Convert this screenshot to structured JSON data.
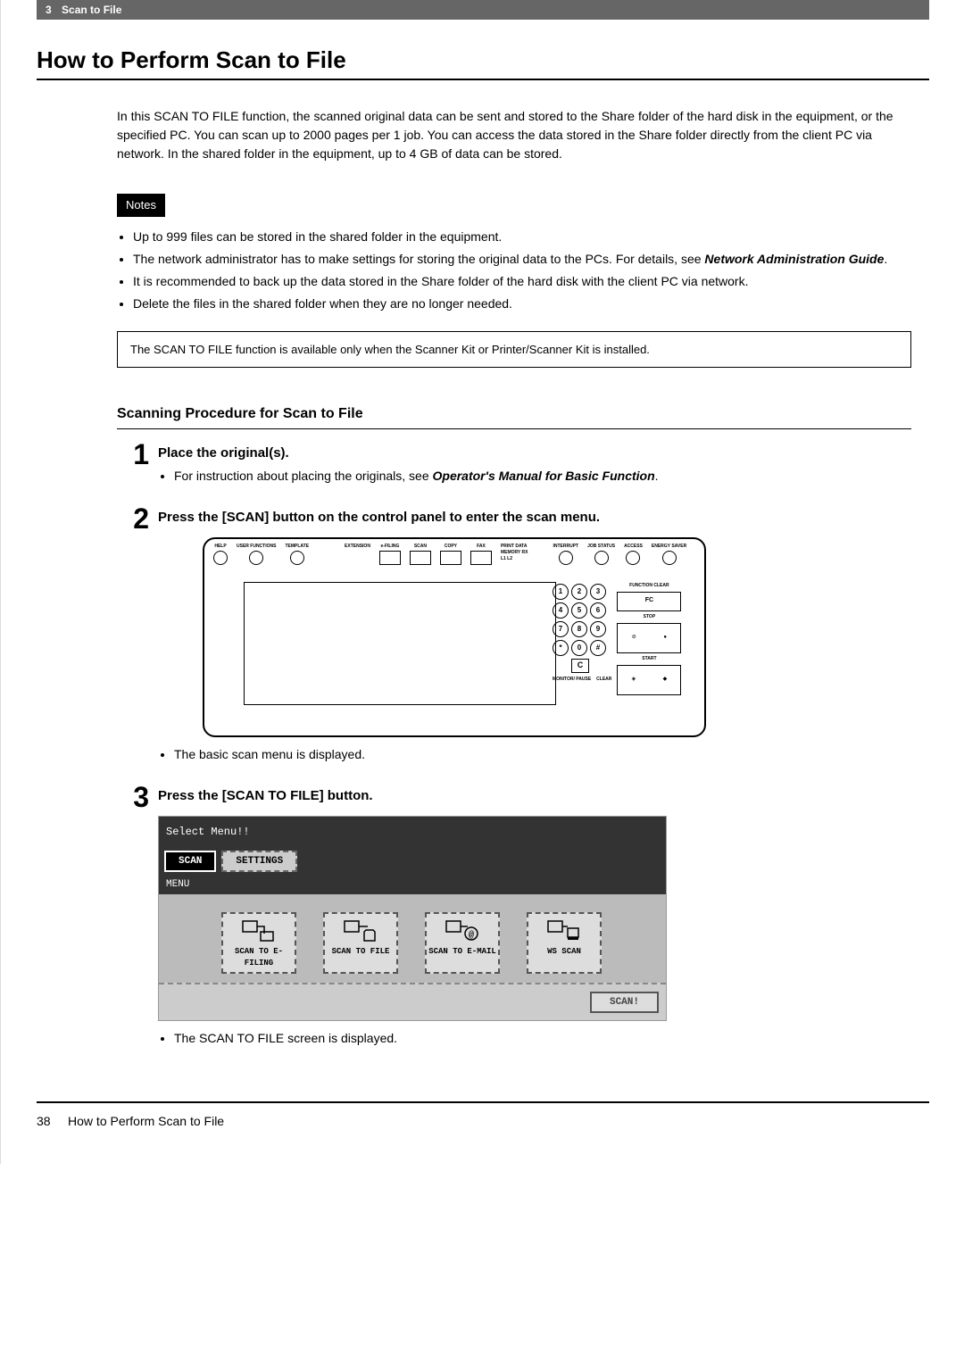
{
  "header": {
    "chapter_num": "3",
    "chapter_title": "Scan to File"
  },
  "title": "How to Perform Scan to File",
  "intro": "In this SCAN TO FILE function, the scanned original data can be sent and stored to the Share folder of the hard disk in the equipment, or the specified PC. You can scan up to 2000 pages per 1 job. You can access the data stored in the Share folder directly from the client PC via network. In the shared folder in the equipment, up to 4 GB of data can be stored.",
  "notes_label": "Notes",
  "notes": [
    "Up to 999 files can be stored in the shared folder in the equipment.",
    "The network administrator has to make settings for storing the original data to the PCs. For details, see ",
    "It is recommended to back up the data stored in the Share folder of the hard disk with the client PC via network.",
    "Delete the files in the shared folder when they are no longer needed."
  ],
  "notes_ref": "Network Administration Guide",
  "info_box": "The SCAN TO FILE function is available only when the Scanner Kit or Printer/Scanner Kit is installed.",
  "subtitle": "Scanning Procedure for Scan to File",
  "steps": {
    "s1": {
      "num": "1",
      "title": "Place the original(s).",
      "bullet": "For instruction about placing the originals, see ",
      "ref": "Operator's Manual for Basic Function"
    },
    "s2": {
      "num": "2",
      "title": "Press the [SCAN] button on the control panel to enter the scan menu.",
      "after": "The basic scan menu is displayed."
    },
    "s3": {
      "num": "3",
      "title": "Press the [SCAN TO FILE] button.",
      "after": "The SCAN TO FILE screen is displayed."
    }
  },
  "panel": {
    "top_labels": {
      "help": "HELP",
      "user_functions": "USER FUNCTIONS",
      "template": "TEMPLATE",
      "extension": "EXTENSION",
      "efiling": "e-FILING",
      "scan": "SCAN",
      "copy": "COPY",
      "fax": "FAX",
      "print_data": "PRINT DATA",
      "memory_rx": "MEMORY RX",
      "l1l2": "L1  L2",
      "interrupt": "INTERRUPT",
      "job_status": "JOB STATUS",
      "access": "ACCESS",
      "energy_saver": "ENERGY SAVER"
    },
    "right": {
      "function_clear": "FUNCTION CLEAR",
      "fc": "FC",
      "stop": "STOP",
      "start": "START",
      "monitor_pause": "MONITOR/ PAUSE",
      "clear": "CLEAR",
      "c": "C"
    },
    "keypad": [
      "1",
      "2",
      "3",
      "4",
      "5",
      "6",
      "7",
      "8",
      "9",
      "*",
      "0",
      "#"
    ]
  },
  "lcd": {
    "header": "Select Menu!!",
    "tab_scan": "SCAN",
    "tab_settings": "SETTINGS",
    "menu_label": "MENU",
    "buttons": {
      "efiling": "SCAN TO E-FILING",
      "file": "SCAN TO FILE",
      "email": "SCAN TO E-MAIL",
      "wsscan": "WS SCAN"
    },
    "scan_btn": "SCAN!"
  },
  "footer": {
    "page": "38",
    "title": "How to Perform Scan to File"
  }
}
